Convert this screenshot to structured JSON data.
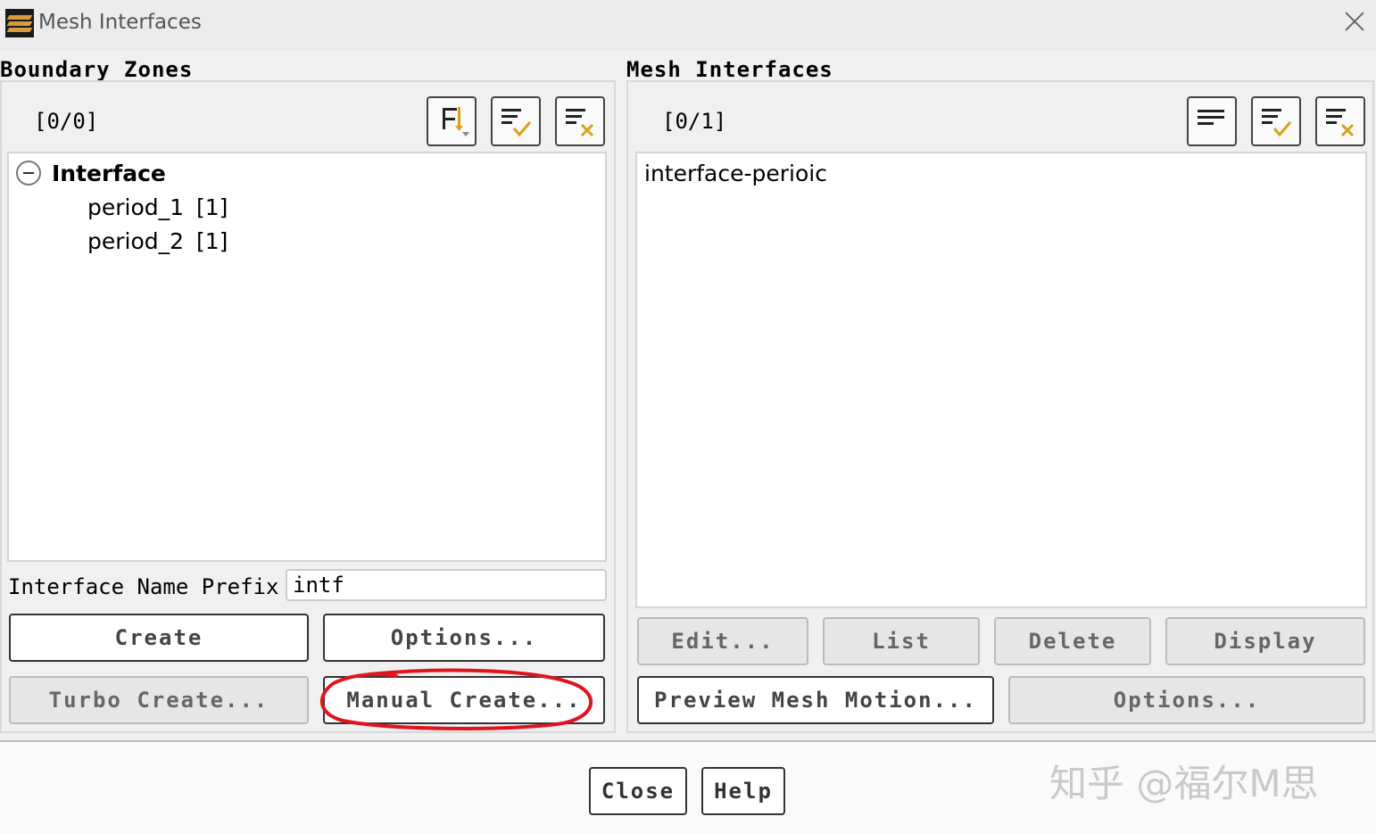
{
  "window": {
    "title": "Mesh Interfaces",
    "icon": "mesh-app-icon"
  },
  "boundary_zones": {
    "title": "Boundary Zones",
    "counter": "[0/0]",
    "toolbar": [
      "filter-sort-icon",
      "select-all-icon",
      "deselect-all-icon"
    ],
    "tree": {
      "group_label": "Interface",
      "items": [
        {
          "name": "period_1",
          "count": "[1]"
        },
        {
          "name": "period_2",
          "count": "[1]"
        }
      ]
    },
    "prefix_label": "Interface Name Prefix",
    "prefix_value": "intf",
    "buttons": {
      "create": "Create",
      "options": "Options...",
      "turbo_create": "Turbo Create...",
      "manual_create": "Manual Create..."
    }
  },
  "mesh_interfaces": {
    "title": "Mesh Interfaces",
    "counter": "[0/1]",
    "toolbar": [
      "list-icon",
      "select-all-icon",
      "deselect-all-icon"
    ],
    "items": [
      "interface-perioic"
    ],
    "buttons": {
      "edit": "Edit...",
      "list": "List",
      "delete": "Delete",
      "display": "Display",
      "preview": "Preview Mesh Motion...",
      "options": "Options..."
    }
  },
  "footer": {
    "close": "Close",
    "help": "Help"
  },
  "watermark": "知乎 @福尔M思",
  "colors": {
    "annotation": "#e0141e",
    "check_accent": "#d9a21b"
  }
}
